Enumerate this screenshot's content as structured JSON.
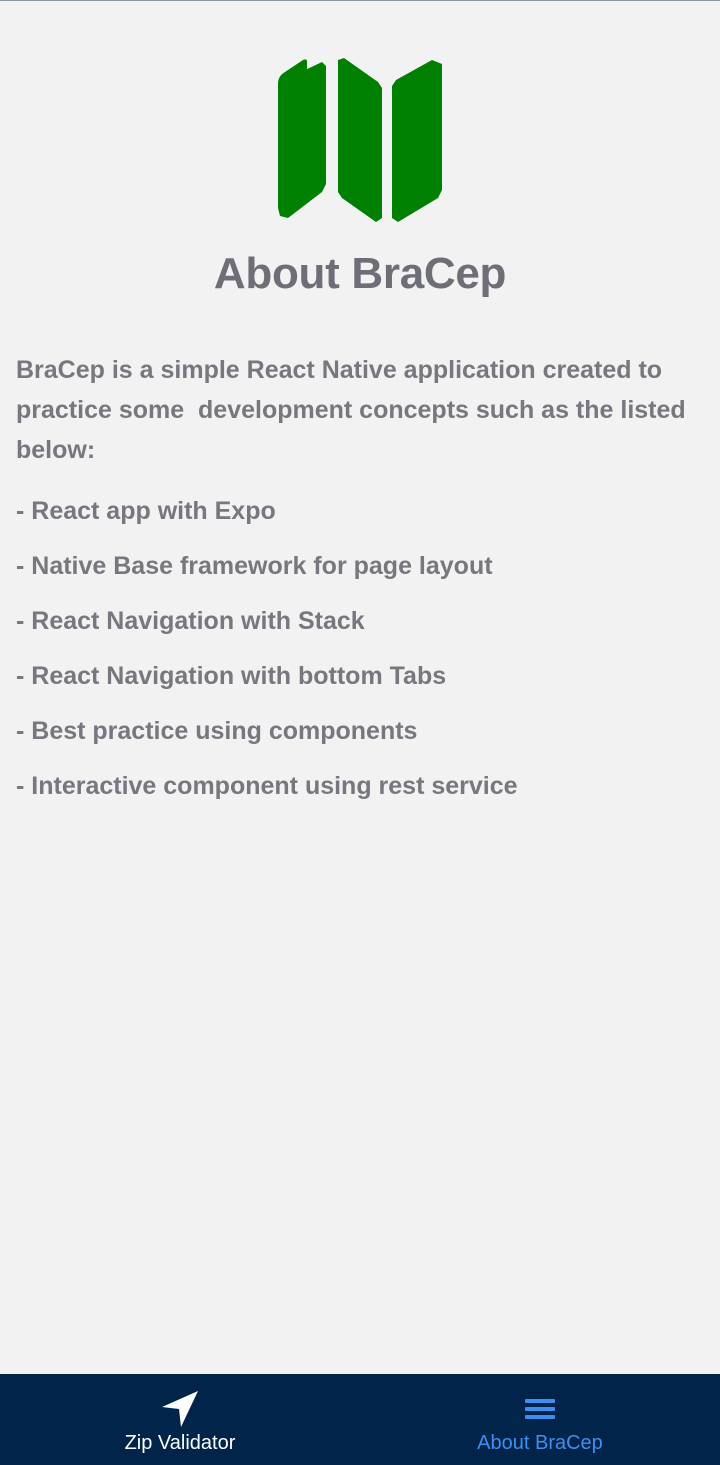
{
  "page": {
    "title": "About BraCep",
    "intro": "BraCep is a simple React Native application created to practice some  development concepts such as the listed below:",
    "features": [
      "- React app with Expo",
      "- Native Base framework for page layout",
      "- React Navigation with Stack",
      "- React Navigation with bottom Tabs",
      "- Best practice using components",
      "- Interactive component using rest service"
    ]
  },
  "logo": {
    "icon": "map-icon",
    "color": "#008000"
  },
  "tabs": [
    {
      "label": "Zip Validator",
      "icon": "navigate-arrow-icon",
      "active": false,
      "color": "#ffffff"
    },
    {
      "label": "About BraCep",
      "icon": "menu-icon",
      "active": true,
      "color": "#3d8ef0"
    }
  ],
  "colors": {
    "background": "#f2f2f2",
    "text": "#77777f",
    "tabbar": "#01244b",
    "active_tab": "#3d8ef0"
  }
}
